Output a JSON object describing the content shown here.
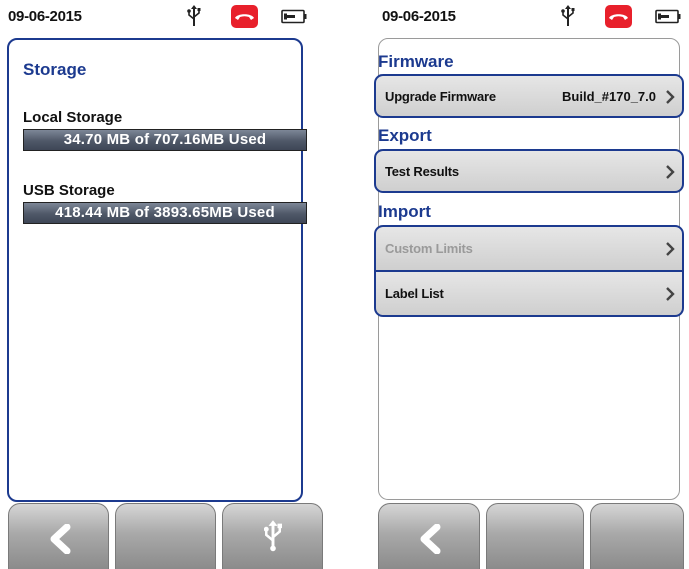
{
  "left": {
    "status": {
      "date": "09-06-2015"
    },
    "storage": {
      "title": "Storage",
      "local_label": "Local Storage",
      "local_usage": "34.70 MB of 707.16MB Used",
      "usb_label": "USB Storage",
      "usb_usage": "418.44 MB of 3893.65MB Used"
    },
    "buttons": [
      "back",
      "blank",
      "usb"
    ]
  },
  "right": {
    "status": {
      "date": "09-06-2015"
    },
    "sections": {
      "firmware": "Firmware",
      "export": "Export",
      "import": "Import"
    },
    "items": {
      "upgrade_firmware": {
        "label": "Upgrade Firmware",
        "value": "Build_#170_7.0"
      },
      "test_results": {
        "label": "Test Results"
      },
      "custom_limits": {
        "label": "Custom Limits",
        "disabled": true
      },
      "label_list": {
        "label": "Label List"
      }
    },
    "buttons": [
      "back",
      "blank",
      "blank"
    ]
  },
  "icons": [
    "usb-icon",
    "phone-hangup-icon",
    "battery-icon",
    "chevron-right-icon",
    "back-arrow-icon"
  ],
  "colors": {
    "accent": "#1c3a8f",
    "call": "#e8202b",
    "bar": "#4f5868"
  }
}
